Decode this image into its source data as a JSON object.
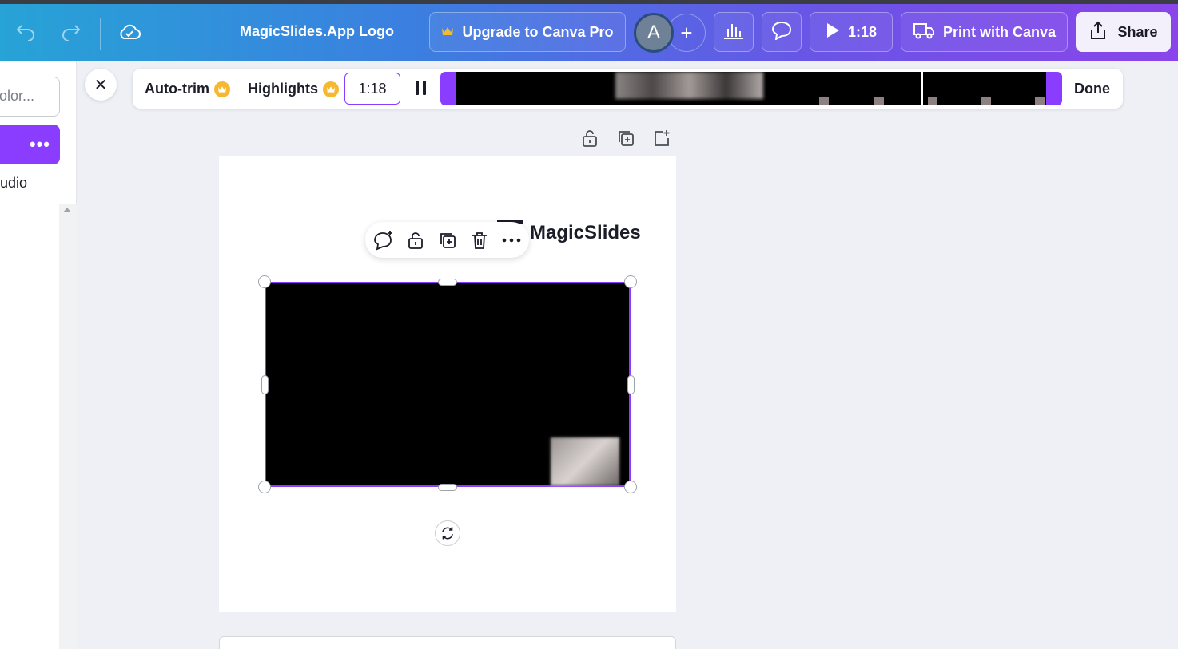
{
  "topbar": {
    "design_title": "MagicSlides.App Logo",
    "upgrade_label": "Upgrade to Canva Pro",
    "avatar_initial": "A",
    "present_time": "1:18",
    "print_label": "Print with Canva",
    "share_label": "Share",
    "icons": [
      "undo-icon",
      "redo-icon",
      "cloud-saved-icon",
      "crown-icon",
      "add-icon",
      "analytics-icon",
      "comment-icon",
      "play-icon",
      "truck-icon",
      "share-icon"
    ]
  },
  "left_panel": {
    "color_placeholder": "olor...",
    "more_label": "•••",
    "audio_label": "udio"
  },
  "trim_toolbar": {
    "autotrim_label": "Auto-trim",
    "highlights_label": "Highlights",
    "time_value": "1:18",
    "done_label": "Done"
  },
  "canvas": {
    "logo_text": "MagicSlides",
    "page_tools": [
      "lock-icon",
      "duplicate-page-icon",
      "add-page-icon"
    ],
    "element_toolbar": [
      "add-comment-icon",
      "lock-icon",
      "duplicate-icon",
      "delete-icon",
      "more-icon"
    ]
  },
  "colors": {
    "accent": "#8b3dff",
    "crown": "#f5b82e",
    "gradient_start": "#27a3d6",
    "gradient_end": "#8a45ea"
  }
}
